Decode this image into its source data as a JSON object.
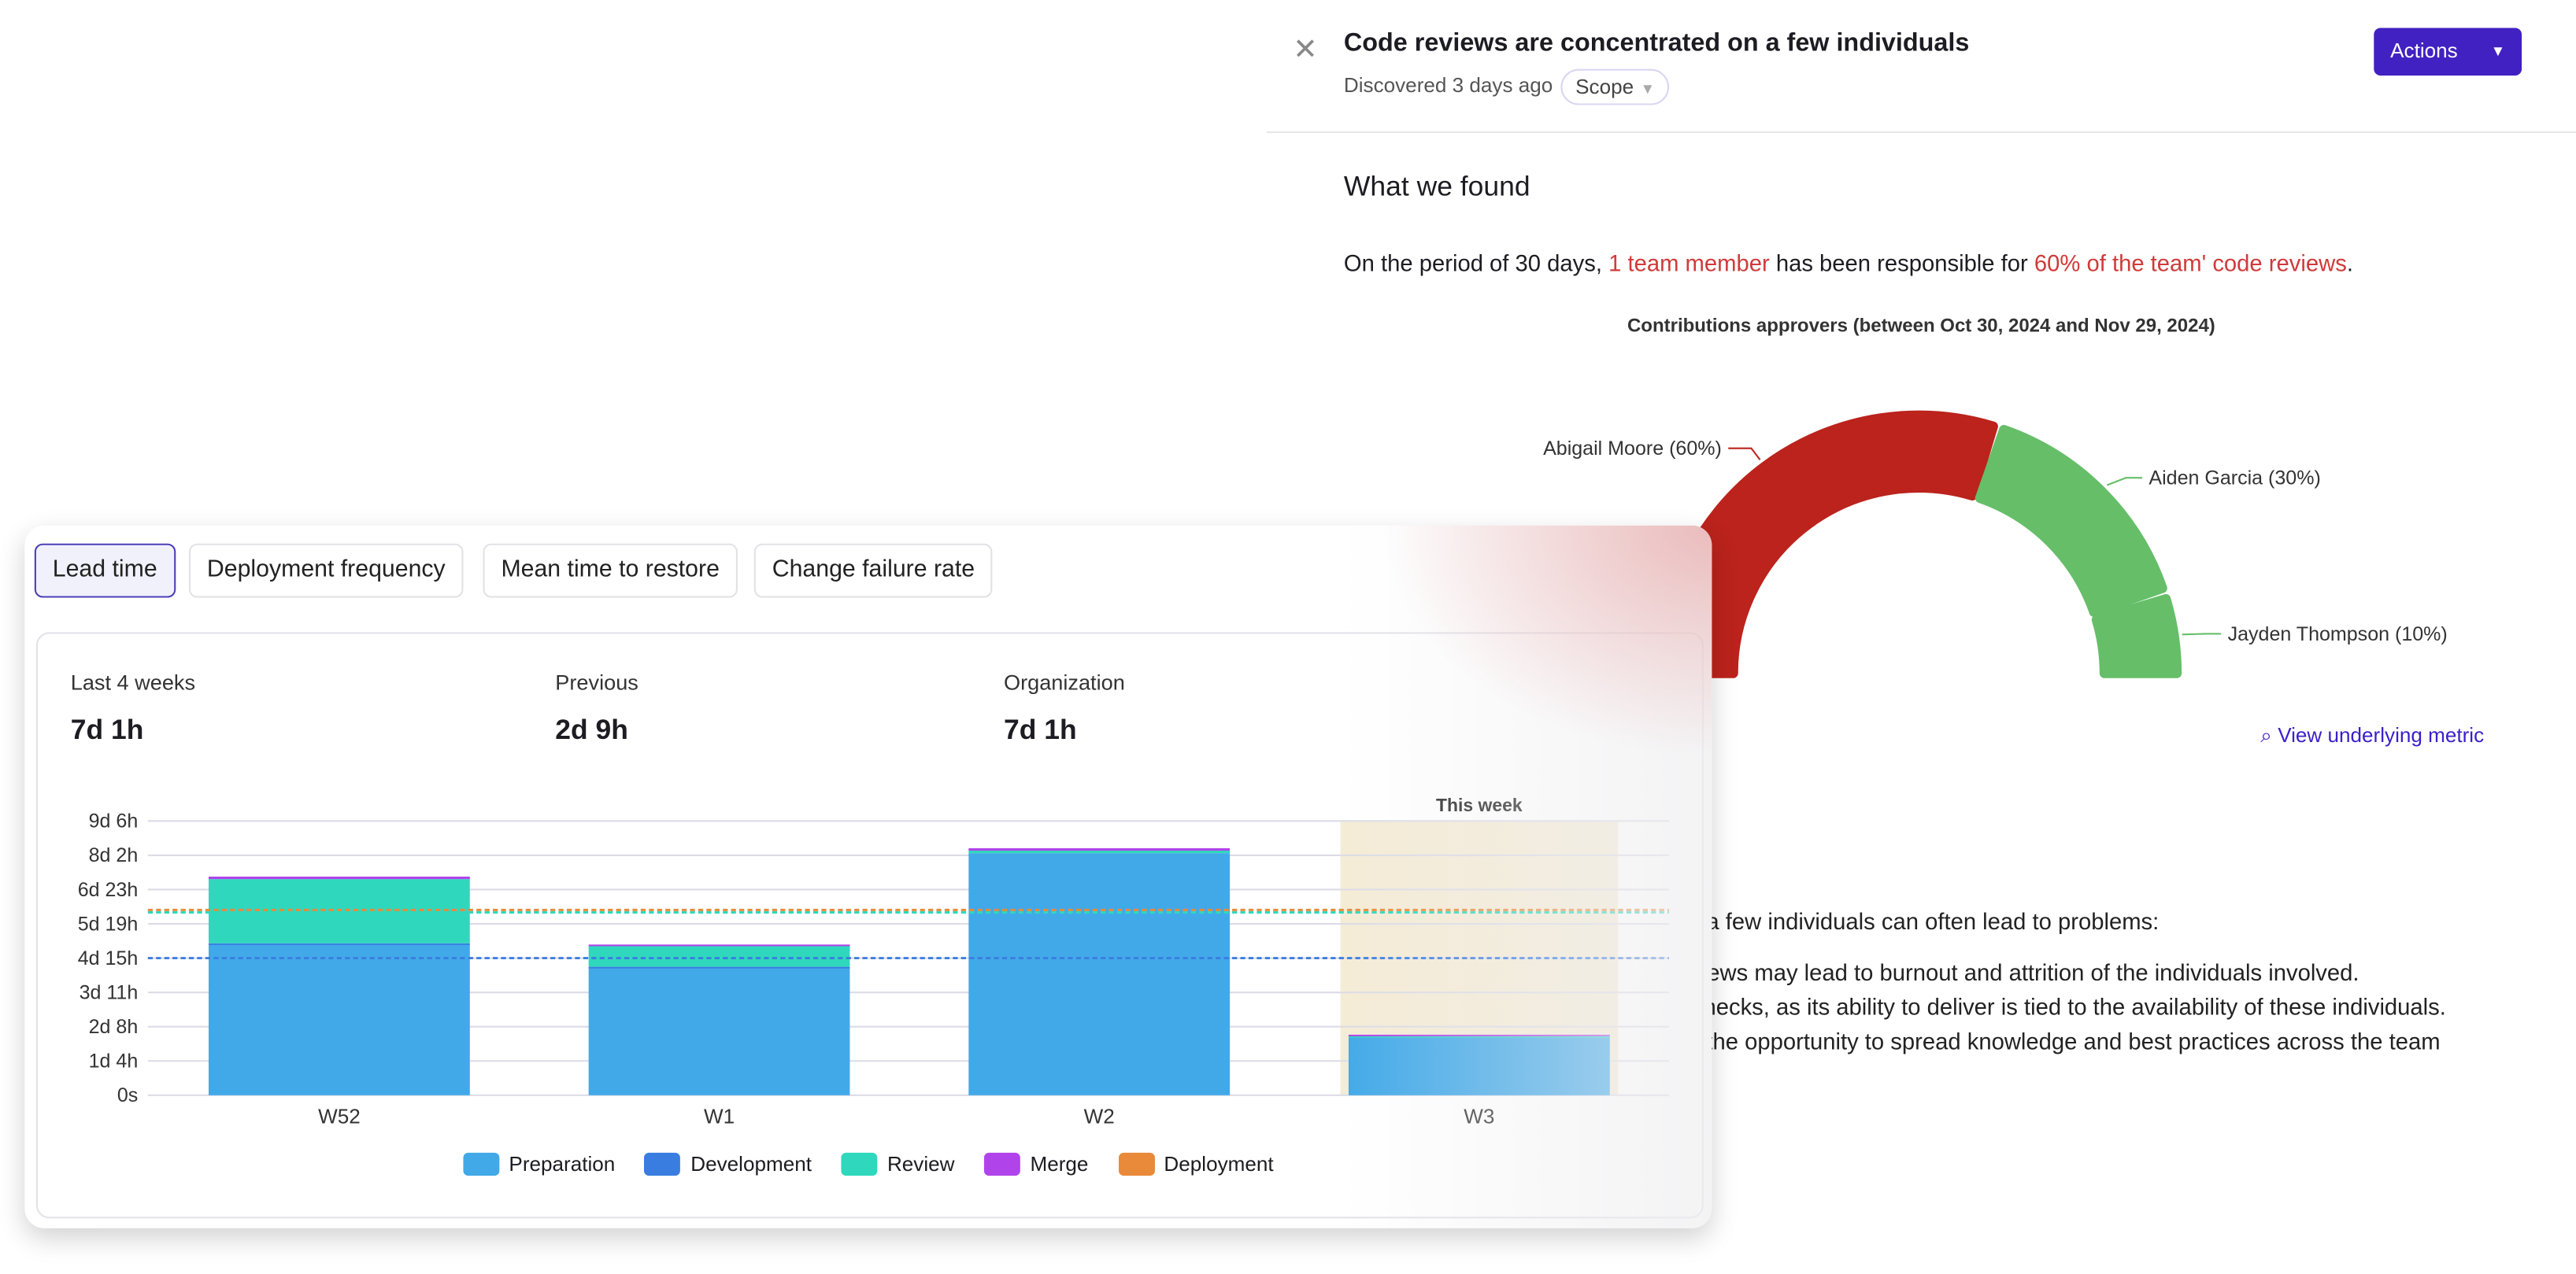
{
  "insight": {
    "close_icon": "close-icon",
    "title": "Code reviews are concentrated on a few individuals",
    "discovered": "Discovered 3 days ago",
    "scope_label": "Scope",
    "actions_label": "Actions",
    "section_title": "What we found",
    "summary": {
      "prefix": "On the period of 30 days, ",
      "highlight1": "1 team member",
      "middle": " has been responsible for ",
      "highlight2": "60% of the team' code reviews",
      "suffix": "."
    },
    "view_link": "View underlying metric",
    "partial_lines": [
      "n a few individuals can often lead to problems:",
      "views may lead to burnout and attrition of the individuals involved.",
      "enecks, as its ability to deliver is tied to the availability of these individuals.",
      "n the opportunity to spread knowledge and best practices across the team"
    ]
  },
  "metrics_panel": {
    "tabs": [
      {
        "label": "Lead time",
        "active": true
      },
      {
        "label": "Deployment frequency"
      },
      {
        "label": "Mean time to restore"
      },
      {
        "label": "Change failure rate"
      }
    ],
    "stats": [
      {
        "label": "Last 4 weeks",
        "value": "7d 1h"
      },
      {
        "label": "Previous",
        "value": "2d 9h"
      },
      {
        "label": "Organization",
        "value": "7d 1h"
      }
    ]
  },
  "chart_data": [
    {
      "type": "pie",
      "variant": "half-donut",
      "title": "Contributions approvers (between Oct 30, 2024 and Nov 29, 2024)",
      "slices": [
        {
          "label": "Abigail Moore (60%)",
          "value": 60,
          "color": "#bb231c"
        },
        {
          "label": "Aiden Garcia (30%)",
          "value": 30,
          "color": "#66be69"
        },
        {
          "label": "Jayden Thompson (10%)",
          "value": 10,
          "color": "#66be69"
        }
      ]
    },
    {
      "type": "bar",
      "stacked": true,
      "unit": "hours",
      "categories": [
        "W52",
        "W1",
        "W2",
        "W3"
      ],
      "highlight": {
        "category": "W3",
        "label": "This week"
      },
      "yticks": [
        "0s",
        "1d 4h",
        "2d 8h",
        "3d 11h",
        "4d 15h",
        "5d 19h",
        "6d 23h",
        "8d 2h",
        "9d 6h"
      ],
      "ylim": [
        0,
        222
      ],
      "grid": true,
      "legend": "bottom",
      "series": [
        {
          "name": "Preparation",
          "color": "#42a9e8",
          "values": [
            122,
            103,
            196,
            47
          ]
        },
        {
          "name": "Development",
          "color": "#3a7de0",
          "values": [
            1,
            1,
            0,
            0
          ]
        },
        {
          "name": "Review",
          "color": "#2fd8bd",
          "values": [
            52,
            17,
            2,
            1
          ]
        },
        {
          "name": "Merge",
          "color": "#b044ea",
          "values": [
            2,
            1,
            2,
            1
          ]
        },
        {
          "name": "Deployment",
          "color": "#e88a3a",
          "values": [
            0,
            0,
            0,
            0
          ]
        }
      ],
      "reference_lines": [
        {
          "value": 111,
          "color": "#3a7de0"
        },
        {
          "value": 148,
          "color": "#2fd8bd"
        },
        {
          "value": 150,
          "color": "#e88a3a"
        }
      ]
    }
  ]
}
